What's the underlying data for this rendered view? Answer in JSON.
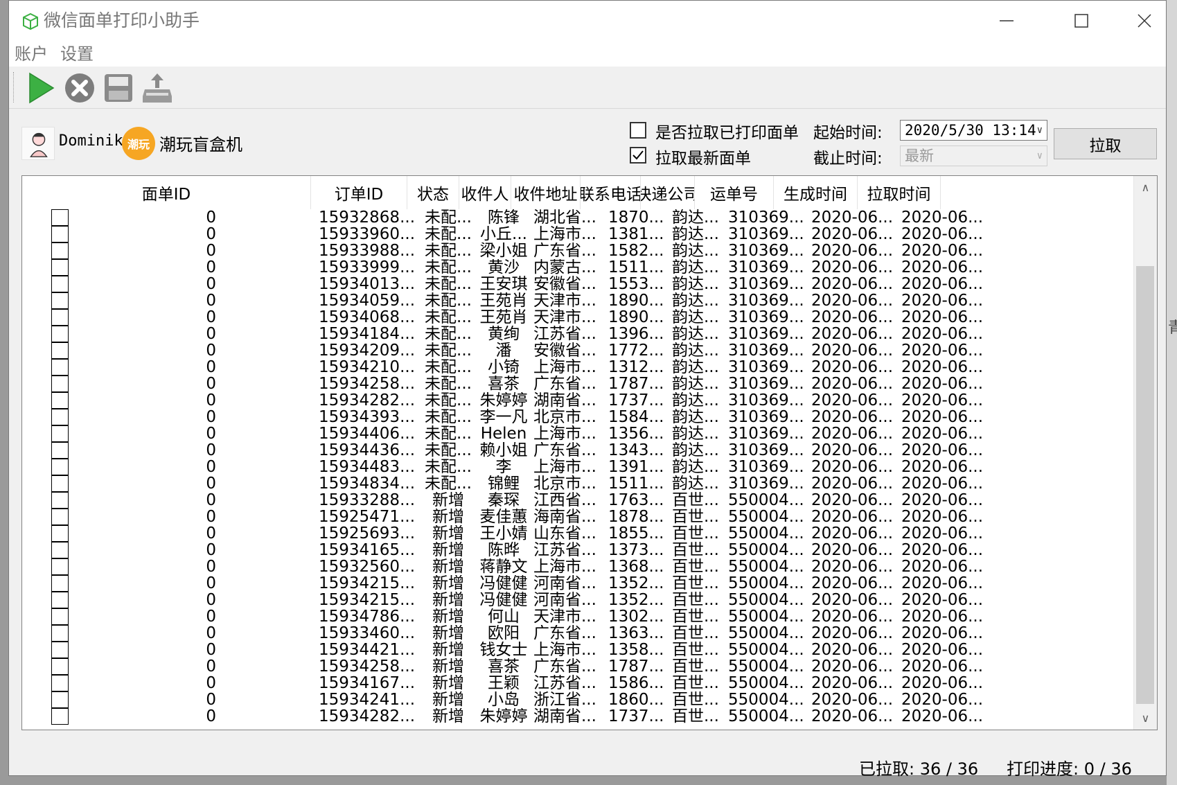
{
  "window": {
    "title": "微信面单打印小助手"
  },
  "menu": {
    "account": "账户",
    "settings": "设置"
  },
  "toolbar": {
    "start_icon": "play-icon",
    "stop_icon": "stop-icon",
    "save_icon": "save-icon",
    "upload_icon": "upload-print-icon"
  },
  "account": {
    "username": "Dominik",
    "shop_logo_text": "潮玩",
    "shop_name": "潮玩盲盒机"
  },
  "filters": {
    "fetch_printed_label": "是否拉取已打印面单",
    "fetch_printed_checked": false,
    "fetch_newest_label": "拉取最新面单",
    "fetch_newest_checked": true,
    "start_time_label": "起始时间:",
    "start_time_value": "2020/5/30  13:14",
    "end_time_label": "截止时间:",
    "end_time_value": "最新",
    "fetch_button": "拉取"
  },
  "table": {
    "columns": [
      "面单ID",
      "订单ID",
      "状态",
      "收件人",
      "收件地址",
      "联系电话",
      "快递公司",
      "运单号",
      "生成时间",
      "拉取时间"
    ],
    "rows": [
      [
        "0",
        "15932868...",
        "未配...",
        "陈锋",
        "湖北省...",
        "1870...",
        "韵达...",
        "310369...",
        "2020-06...",
        "2020-06..."
      ],
      [
        "0",
        "15933960...",
        "未配...",
        "小丘...",
        "上海市...",
        "1381...",
        "韵达...",
        "310369...",
        "2020-06...",
        "2020-06..."
      ],
      [
        "0",
        "15933988...",
        "未配...",
        "梁小姐",
        "广东省...",
        "1582...",
        "韵达...",
        "310369...",
        "2020-06...",
        "2020-06..."
      ],
      [
        "0",
        "15933999...",
        "未配...",
        "黄沙",
        "内蒙古...",
        "1511...",
        "韵达...",
        "310369...",
        "2020-06...",
        "2020-06..."
      ],
      [
        "0",
        "15934013...",
        "未配...",
        "王安琪",
        "安徽省...",
        "1553...",
        "韵达...",
        "310369...",
        "2020-06...",
        "2020-06..."
      ],
      [
        "0",
        "15934059...",
        "未配...",
        "王苑肖",
        "天津市...",
        "1890...",
        "韵达...",
        "310369...",
        "2020-06...",
        "2020-06..."
      ],
      [
        "0",
        "15934068...",
        "未配...",
        "王苑肖",
        "天津市...",
        "1890...",
        "韵达...",
        "310369...",
        "2020-06...",
        "2020-06..."
      ],
      [
        "0",
        "15934184...",
        "未配...",
        "黄绚",
        "江苏省...",
        "1396...",
        "韵达...",
        "310369...",
        "2020-06...",
        "2020-06..."
      ],
      [
        "0",
        "15934209...",
        "未配...",
        "潘",
        "安徽省...",
        "1772...",
        "韵达...",
        "310369...",
        "2020-06...",
        "2020-06..."
      ],
      [
        "0",
        "15934210...",
        "未配...",
        "小锜",
        "上海市...",
        "1312...",
        "韵达...",
        "310369...",
        "2020-06...",
        "2020-06..."
      ],
      [
        "0",
        "15934258...",
        "未配...",
        "喜茶",
        "广东省...",
        "1787...",
        "韵达...",
        "310369...",
        "2020-06...",
        "2020-06..."
      ],
      [
        "0",
        "15934282...",
        "未配...",
        "朱婷婷",
        "湖南省...",
        "1737...",
        "韵达...",
        "310369...",
        "2020-06...",
        "2020-06..."
      ],
      [
        "0",
        "15934393...",
        "未配...",
        "李一凡",
        "北京市...",
        "1584...",
        "韵达...",
        "310369...",
        "2020-06...",
        "2020-06..."
      ],
      [
        "0",
        "15934406...",
        "未配...",
        "Helen",
        "上海市...",
        "1356...",
        "韵达...",
        "310369...",
        "2020-06...",
        "2020-06..."
      ],
      [
        "0",
        "15934436...",
        "未配...",
        "赖小姐",
        "广东省...",
        "1343...",
        "韵达...",
        "310369...",
        "2020-06...",
        "2020-06..."
      ],
      [
        "0",
        "15934483...",
        "未配...",
        "李",
        "上海市...",
        "1391...",
        "韵达...",
        "310369...",
        "2020-06...",
        "2020-06..."
      ],
      [
        "0",
        "15934834...",
        "未配...",
        "锦鲤",
        "北京市...",
        "1511...",
        "韵达...",
        "310369...",
        "2020-06...",
        "2020-06..."
      ],
      [
        "0",
        "15933288...",
        "新增",
        "秦琛",
        "江西省...",
        "1763...",
        "百世...",
        "550004...",
        "2020-06...",
        "2020-06..."
      ],
      [
        "0",
        "15925471...",
        "新增",
        "麦佳蕙",
        "海南省...",
        "1878...",
        "百世...",
        "550004...",
        "2020-06...",
        "2020-06..."
      ],
      [
        "0",
        "15925693...",
        "新增",
        "王小婧",
        "山东省...",
        "1855...",
        "百世...",
        "550004...",
        "2020-06...",
        "2020-06..."
      ],
      [
        "0",
        "15934165...",
        "新增",
        "陈晔",
        "江苏省...",
        "1373...",
        "百世...",
        "550004...",
        "2020-06...",
        "2020-06..."
      ],
      [
        "0",
        "15932560...",
        "新增",
        "蒋静文",
        "上海市...",
        "1368...",
        "百世...",
        "550004...",
        "2020-06...",
        "2020-06..."
      ],
      [
        "0",
        "15934215...",
        "新增",
        "冯健健",
        "河南省...",
        "1352...",
        "百世...",
        "550004...",
        "2020-06...",
        "2020-06..."
      ],
      [
        "0",
        "15934215...",
        "新增",
        "冯健健",
        "河南省...",
        "1352...",
        "百世...",
        "550004...",
        "2020-06...",
        "2020-06..."
      ],
      [
        "0",
        "15934786...",
        "新增",
        "何山",
        "天津市...",
        "1302...",
        "百世...",
        "550004...",
        "2020-06...",
        "2020-06..."
      ],
      [
        "0",
        "15933460...",
        "新增",
        "欧阳",
        "广东省...",
        "1363...",
        "百世...",
        "550004...",
        "2020-06...",
        "2020-06..."
      ],
      [
        "0",
        "15934421...",
        "新增",
        "钱女士",
        "上海市...",
        "1358...",
        "百世...",
        "550004...",
        "2020-06...",
        "2020-06..."
      ],
      [
        "0",
        "15934258...",
        "新增",
        "喜茶",
        "广东省...",
        "1787...",
        "百世...",
        "550004...",
        "2020-06...",
        "2020-06..."
      ],
      [
        "0",
        "15934167...",
        "新增",
        "王颖",
        "江苏省...",
        "1586...",
        "百世...",
        "550004...",
        "2020-06...",
        "2020-06..."
      ],
      [
        "0",
        "15934241...",
        "新增",
        "小岛",
        "浙江省...",
        "1860...",
        "百世...",
        "550004...",
        "2020-06...",
        "2020-06..."
      ],
      [
        "0",
        "15934282...",
        "新增",
        "朱婷婷",
        "湖南省...",
        "1737...",
        "百世...",
        "550004...",
        "2020-06...",
        "2020-06..."
      ]
    ]
  },
  "status": {
    "pulled": "已拉取: 36 / 36",
    "print_progress": "打印进度: 0 / 36"
  },
  "colors": {
    "play_green": "#3cb043",
    "logo_orange": "#f6a623",
    "window_bg": "#f0f0f0"
  }
}
